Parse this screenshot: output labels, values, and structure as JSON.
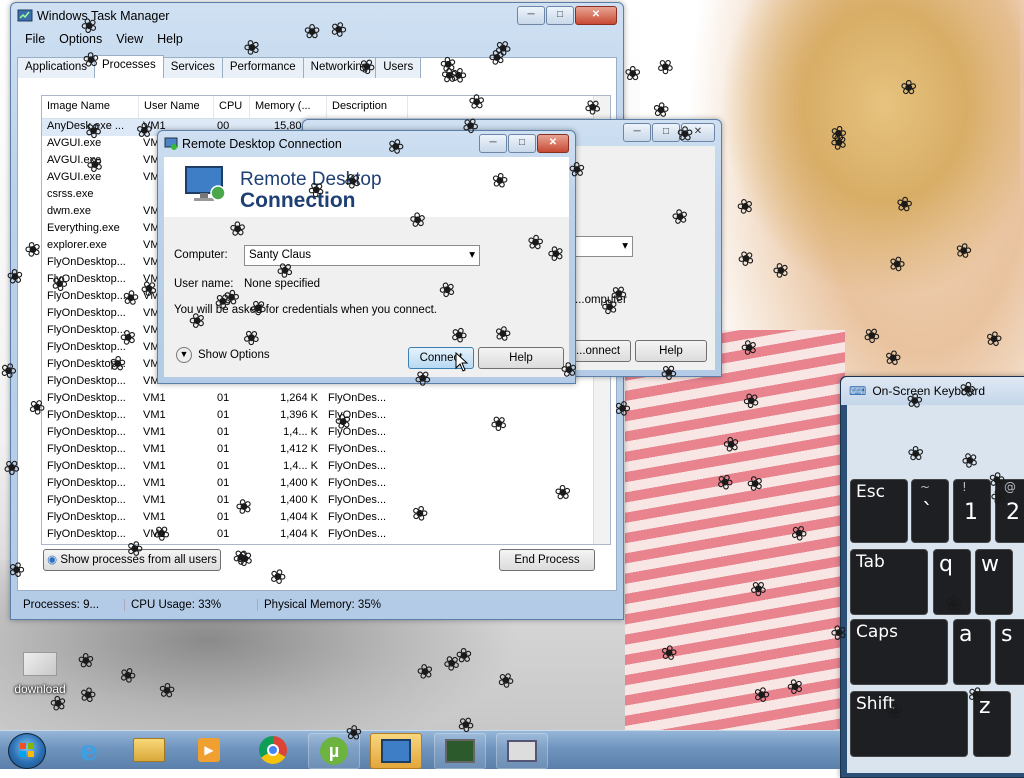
{
  "task_manager": {
    "title": "Windows Task Manager",
    "menu": [
      "File",
      "Options",
      "View",
      "Help"
    ],
    "tabs": [
      "Applications",
      "Processes",
      "Services",
      "Performance",
      "Networking",
      "Users"
    ],
    "active_tab": "Processes",
    "columns": [
      "Image Name",
      "User Name",
      "CPU",
      "Memory (...",
      "Description"
    ],
    "rows": [
      {
        "name": "AnyDesk.exe ...",
        "user": "VM1",
        "cpu": "00",
        "mem": "15,804 K",
        "desc": ""
      },
      {
        "name": "AVGUI.exe",
        "user": "VM1",
        "cpu": "",
        "mem": "",
        "desc": ""
      },
      {
        "name": "AVGUI.exe",
        "user": "VM1",
        "cpu": "",
        "mem": "",
        "desc": ""
      },
      {
        "name": "AVGUI.exe",
        "user": "VM1",
        "cpu": "",
        "mem": "",
        "desc": ""
      },
      {
        "name": "csrss.exe",
        "user": "",
        "cpu": "",
        "mem": "",
        "desc": ""
      },
      {
        "name": "dwm.exe",
        "user": "VM1",
        "cpu": "",
        "mem": "",
        "desc": ""
      },
      {
        "name": "Everything.exe",
        "user": "VM1",
        "cpu": "",
        "mem": "",
        "desc": ""
      },
      {
        "name": "explorer.exe",
        "user": "VM1",
        "cpu": "",
        "mem": "",
        "desc": ""
      },
      {
        "name": "FlyOnDesktop...",
        "user": "VM1",
        "cpu": "",
        "mem": "",
        "desc": ""
      },
      {
        "name": "FlyOnDesktop...",
        "user": "VM1",
        "cpu": "",
        "mem": "",
        "desc": ""
      },
      {
        "name": "FlyOnDesktop...",
        "user": "VM1",
        "cpu": "",
        "mem": "",
        "desc": ""
      },
      {
        "name": "FlyOnDesktop...",
        "user": "VM1",
        "cpu": "",
        "mem": "",
        "desc": ""
      },
      {
        "name": "FlyOnDesktop...",
        "user": "VM1",
        "cpu": "",
        "mem": "",
        "desc": ""
      },
      {
        "name": "FlyOnDesktop...",
        "user": "VM1",
        "cpu": "",
        "mem": "",
        "desc": ""
      },
      {
        "name": "FlyOnDesktop...",
        "user": "VM1",
        "cpu": "",
        "mem": "",
        "desc": ""
      },
      {
        "name": "FlyOnDesktop...",
        "user": "VM1",
        "cpu": "",
        "mem": "",
        "desc": ""
      },
      {
        "name": "FlyOnDesktop...",
        "user": "VM1",
        "cpu": "01",
        "mem": "1,264 K",
        "desc": "FlyOnDes..."
      },
      {
        "name": "FlyOnDesktop...",
        "user": "VM1",
        "cpu": "01",
        "mem": "1,396 K",
        "desc": "FlyOnDes..."
      },
      {
        "name": "FlyOnDesktop...",
        "user": "VM1",
        "cpu": "01",
        "mem": "1,4... K",
        "desc": "FlyOnDes..."
      },
      {
        "name": "FlyOnDesktop...",
        "user": "VM1",
        "cpu": "01",
        "mem": "1,412 K",
        "desc": "FlyOnDes..."
      },
      {
        "name": "FlyOnDesktop...",
        "user": "VM1",
        "cpu": "01",
        "mem": "1,4... K",
        "desc": "FlyOnDes..."
      },
      {
        "name": "FlyOnDesktop...",
        "user": "VM1",
        "cpu": "01",
        "mem": "1,400 K",
        "desc": "FlyOnDes..."
      },
      {
        "name": "FlyOnDesktop...",
        "user": "VM1",
        "cpu": "01",
        "mem": "1,400 K",
        "desc": "FlyOnDes..."
      },
      {
        "name": "FlyOnDesktop...",
        "user": "VM1",
        "cpu": "01",
        "mem": "1,404 K",
        "desc": "FlyOnDes..."
      },
      {
        "name": "FlyOnDesktop...",
        "user": "VM1",
        "cpu": "01",
        "mem": "1,404 K",
        "desc": "FlyOnDes..."
      }
    ],
    "show_all_label": "Show processes from all users",
    "end_process_label": "End Process",
    "status": {
      "processes": "Processes: 9...",
      "cpu": "CPU Usage: 33%",
      "memory": "Physical Memory: 35%"
    }
  },
  "rdc_back": {
    "show_computer_label": "...omputer",
    "connect_label": "...onnect",
    "help_label": "Help"
  },
  "rdc": {
    "title": "Remote Desktop Connection",
    "banner_line1": "Remote Desktop",
    "banner_line2": "Connection",
    "computer_label": "Computer:",
    "computer_value": "Santy Claus",
    "username_label": "User name:",
    "username_value": "None specified",
    "info_text": "You will be asked for credentials when you connect.",
    "show_options_label": "Show Options",
    "connect_label": "Connect",
    "help_label": "Help"
  },
  "osk": {
    "title": "On-Screen Keyboard",
    "keys": {
      "esc": "Esc",
      "tilde_top": "~",
      "tilde_bottom": "`",
      "one_top": "!",
      "one_bottom": "1",
      "two_top": "@",
      "two_bottom": "2",
      "tab": "Tab",
      "q": "q",
      "w": "w",
      "caps": "Caps",
      "a": "a",
      "s": "s",
      "shift": "Shift",
      "z": "z"
    }
  },
  "desktop": {
    "icon_label": "download"
  },
  "taskbar": {
    "items": [
      "start-orb",
      "internet-explorer-icon",
      "file-explorer-icon",
      "media-player-icon",
      "chrome-icon",
      "utorrent-icon",
      "remote-desktop-icon",
      "task-manager-icon",
      "on-screen-keyboard-icon"
    ]
  },
  "colors": {
    "titlebar": "#bcd2ea",
    "close_button": "#c74a34",
    "banner_text": "#1e3f74",
    "osk_key": "#1d1f22",
    "taskbar": "#6f94bd",
    "active_taskbar_item": "#e3a63b"
  }
}
